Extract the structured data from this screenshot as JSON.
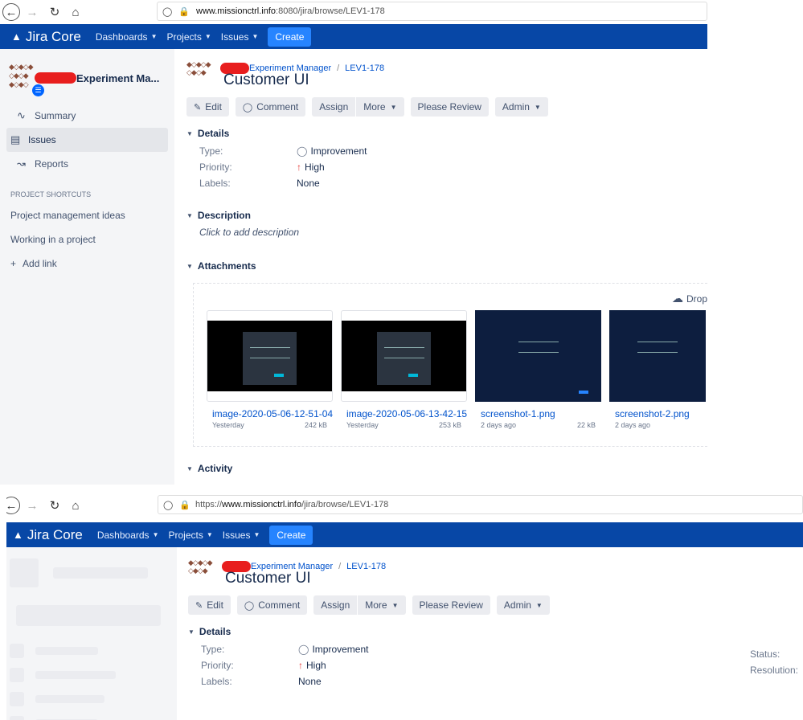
{
  "shot1": {
    "url_domain": "www.missionctrl.info",
    "url_rest": ":8080/jira/browse/LEV1-178"
  },
  "shot2": {
    "url_prefix": "https://",
    "url_domain": "www.missionctrl.info",
    "url_rest": "/jira/browse/LEV1-178"
  },
  "jira": {
    "logo": "Jira Core",
    "nav": [
      "Dashboards",
      "Projects",
      "Issues"
    ],
    "create": "Create"
  },
  "sidebar": {
    "project_name": "Experiment Ma...",
    "items": [
      "Summary",
      "Issues",
      "Reports"
    ],
    "shortcuts_title": "PROJECT SHORTCUTS",
    "shortcuts": [
      "Project management ideas",
      "Working in a project"
    ],
    "add_link": "Add link"
  },
  "issue": {
    "project": "Experiment Manager",
    "key": "LEV1-178",
    "title": "Customer UI",
    "buttons": [
      "Edit",
      "Comment",
      "Assign",
      "More",
      "Please Review",
      "Admin"
    ],
    "details_title": "Details",
    "type_label": "Type:",
    "type_value": "Improvement",
    "priority_label": "Priority:",
    "priority_value": "High",
    "labels_label": "Labels:",
    "labels_value": "None",
    "status_label": "Status:",
    "resolution_label": "Resolution:",
    "description_title": "Description",
    "description_placeholder": "Click to add description",
    "attachments_title": "Attachments",
    "drop_label": "Drop",
    "activity_title": "Activity",
    "attachments": [
      {
        "name": "image-2020-05-06-12-51-04",
        "date": "Yesterday",
        "size": "242 kB"
      },
      {
        "name": "image-2020-05-06-13-42-15",
        "date": "Yesterday",
        "size": "253 kB"
      },
      {
        "name": "screenshot-1.png",
        "date": "2 days ago",
        "size": "22 kB"
      },
      {
        "name": "screenshot-2.png",
        "date": "2 days ago",
        "size": ""
      }
    ]
  },
  "icons": [
    "back-icon",
    "forward-icon",
    "reload-icon",
    "home-icon",
    "shield-icon",
    "lock-icon",
    "pencil-icon",
    "comment-icon",
    "lightbulb-icon",
    "arrow-up-icon",
    "cloud-upload-icon"
  ],
  "colors": {
    "jira_blue": "#0747a6",
    "create_blue": "#2684ff",
    "link": "#0052cc",
    "priority_high": "#e53935"
  }
}
